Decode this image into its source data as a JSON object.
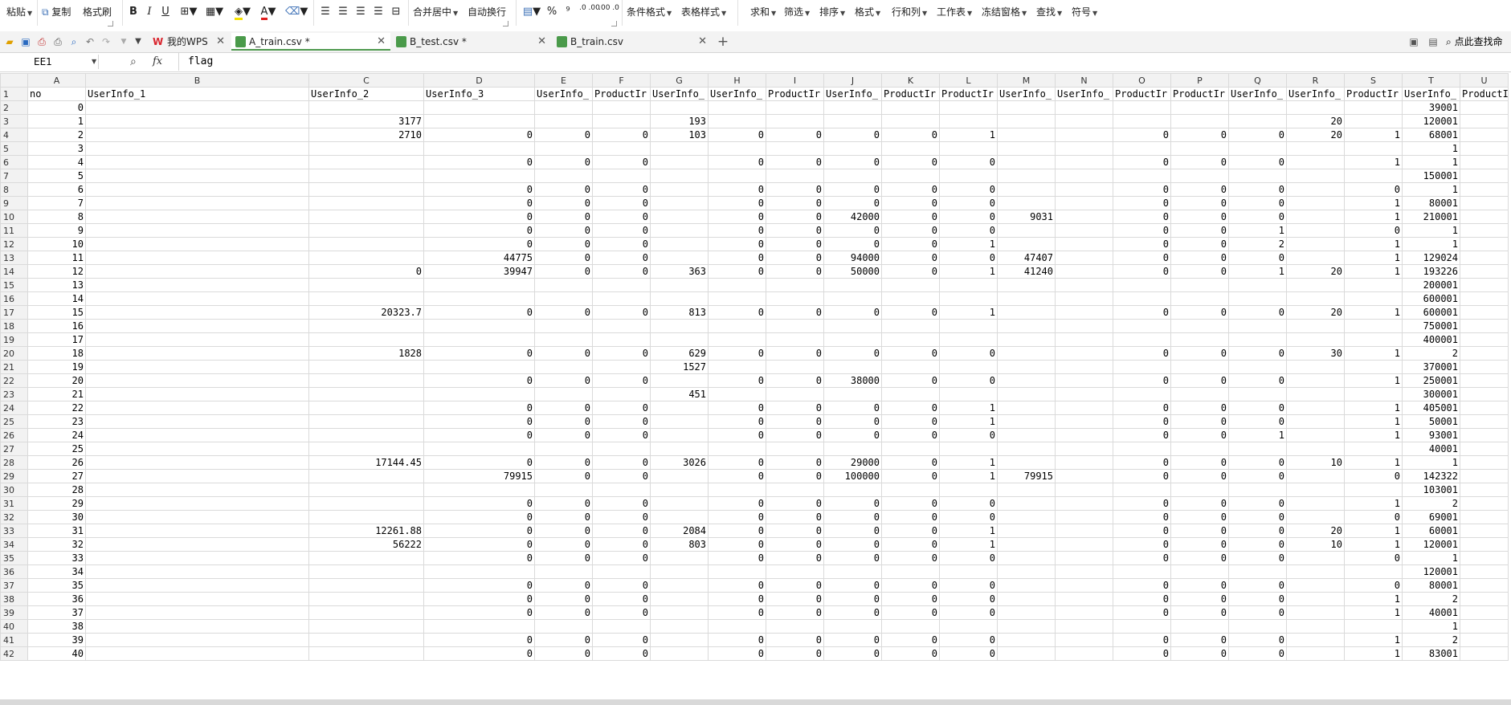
{
  "ribbon": {
    "paste": "粘贴",
    "copy": "复制",
    "format_painter": "格式刷",
    "bold": "B",
    "italic": "I",
    "underline": "U",
    "font_color_letter": "A",
    "merge_center": "合并居中",
    "wrap_text": "自动换行",
    "percent": "%",
    "comma": "⁹",
    "inc_decimal": ".0 .00",
    "dec_decimal": ".00 .0",
    "cond_format": "条件格式",
    "table_style": "表格样式",
    "sum": "求和",
    "filter": "筛选",
    "sort": "排序",
    "format": "格式",
    "rows_cols": "行和列",
    "worksheet": "工作表",
    "freeze": "冻结窗格",
    "find": "查找",
    "symbol": "符号"
  },
  "tabs": [
    {
      "label": "我的WPS",
      "closable": false,
      "active": false
    },
    {
      "label": "A_train.csv *",
      "closable": true,
      "active": true
    },
    {
      "label": "B_test.csv *",
      "closable": true,
      "active": false
    },
    {
      "label": "B_train.csv",
      "closable": true,
      "active": false
    }
  ],
  "search_hint": "点此查找命",
  "formula_bar": {
    "cell_ref": "EE1",
    "fx": "fx",
    "content": "flag"
  },
  "columns": [
    "A",
    "B",
    "C",
    "D",
    "E",
    "F",
    "G",
    "H",
    "I",
    "J",
    "K",
    "L",
    "M",
    "N",
    "O",
    "P",
    "Q",
    "R",
    "S",
    "T",
    "U"
  ],
  "headers": [
    "no",
    "UserInfo_1",
    "UserInfo_2",
    "UserInfo_3",
    "UserInfo_",
    "ProductIr",
    "UserInfo_",
    "UserInfo_",
    "ProductIr",
    "UserInfo_",
    "ProductIr",
    "ProductIr",
    "UserInfo_",
    "UserInfo_",
    "ProductIr",
    "ProductIr",
    "UserInfo_",
    "UserInfo_",
    "ProductIr",
    "UserInfo_",
    "ProductI"
  ],
  "rows": [
    [
      "0",
      "",
      "",
      "",
      "",
      "",
      "",
      "",
      "",
      "",
      "",
      "",
      "",
      "",
      "",
      "",
      "",
      "",
      "",
      "39001",
      ""
    ],
    [
      "1",
      "",
      "3177",
      "",
      "",
      "",
      "193",
      "",
      "",
      "",
      "",
      "",
      "",
      "",
      "",
      "",
      "",
      "20",
      "",
      "120001",
      ""
    ],
    [
      "2",
      "",
      "2710",
      "0",
      "0",
      "0",
      "103",
      "0",
      "0",
      "0",
      "0",
      "1",
      "",
      "",
      "0",
      "0",
      "0",
      "20",
      "1",
      "68001",
      ""
    ],
    [
      "3",
      "",
      "",
      "",
      "",
      "",
      "",
      "",
      "",
      "",
      "",
      "",
      "",
      "",
      "",
      "",
      "",
      "",
      "",
      "1",
      ""
    ],
    [
      "4",
      "",
      "",
      "0",
      "0",
      "0",
      "",
      "0",
      "0",
      "0",
      "0",
      "0",
      "",
      "",
      "0",
      "0",
      "0",
      "",
      "1",
      "1",
      ""
    ],
    [
      "5",
      "",
      "",
      "",
      "",
      "",
      "",
      "",
      "",
      "",
      "",
      "",
      "",
      "",
      "",
      "",
      "",
      "",
      "",
      "150001",
      ""
    ],
    [
      "6",
      "",
      "",
      "0",
      "0",
      "0",
      "",
      "0",
      "0",
      "0",
      "0",
      "0",
      "",
      "",
      "0",
      "0",
      "0",
      "",
      "0",
      "1",
      ""
    ],
    [
      "7",
      "",
      "",
      "0",
      "0",
      "0",
      "",
      "0",
      "0",
      "0",
      "0",
      "0",
      "",
      "",
      "0",
      "0",
      "0",
      "",
      "1",
      "80001",
      ""
    ],
    [
      "8",
      "",
      "",
      "0",
      "0",
      "0",
      "",
      "0",
      "0",
      "42000",
      "0",
      "0",
      "9031",
      "",
      "0",
      "0",
      "0",
      "",
      "1",
      "210001",
      ""
    ],
    [
      "9",
      "",
      "",
      "0",
      "0",
      "0",
      "",
      "0",
      "0",
      "0",
      "0",
      "0",
      "",
      "",
      "0",
      "0",
      "1",
      "",
      "0",
      "1",
      ""
    ],
    [
      "10",
      "",
      "",
      "0",
      "0",
      "0",
      "",
      "0",
      "0",
      "0",
      "0",
      "1",
      "",
      "",
      "0",
      "0",
      "2",
      "",
      "1",
      "1",
      ""
    ],
    [
      "11",
      "",
      "",
      "44775",
      "0",
      "0",
      "",
      "0",
      "0",
      "94000",
      "0",
      "0",
      "47407",
      "",
      "0",
      "0",
      "0",
      "",
      "1",
      "129024",
      ""
    ],
    [
      "12",
      "",
      "0",
      "39947",
      "0",
      "0",
      "363",
      "0",
      "0",
      "50000",
      "0",
      "1",
      "41240",
      "",
      "0",
      "0",
      "1",
      "20",
      "1",
      "193226",
      ""
    ],
    [
      "13",
      "",
      "",
      "",
      "",
      "",
      "",
      "",
      "",
      "",
      "",
      "",
      "",
      "",
      "",
      "",
      "",
      "",
      "",
      "200001",
      ""
    ],
    [
      "14",
      "",
      "",
      "",
      "",
      "",
      "",
      "",
      "",
      "",
      "",
      "",
      "",
      "",
      "",
      "",
      "",
      "",
      "",
      "600001",
      ""
    ],
    [
      "15",
      "",
      "20323.7",
      "0",
      "0",
      "0",
      "813",
      "0",
      "0",
      "0",
      "0",
      "1",
      "",
      "",
      "0",
      "0",
      "0",
      "20",
      "1",
      "600001",
      ""
    ],
    [
      "16",
      "",
      "",
      "",
      "",
      "",
      "",
      "",
      "",
      "",
      "",
      "",
      "",
      "",
      "",
      "",
      "",
      "",
      "",
      "750001",
      ""
    ],
    [
      "17",
      "",
      "",
      "",
      "",
      "",
      "",
      "",
      "",
      "",
      "",
      "",
      "",
      "",
      "",
      "",
      "",
      "",
      "",
      "400001",
      ""
    ],
    [
      "18",
      "",
      "1828",
      "0",
      "0",
      "0",
      "629",
      "0",
      "0",
      "0",
      "0",
      "0",
      "",
      "",
      "0",
      "0",
      "0",
      "30",
      "1",
      "2",
      ""
    ],
    [
      "19",
      "",
      "",
      "",
      "",
      "",
      "1527",
      "",
      "",
      "",
      "",
      "",
      "",
      "",
      "",
      "",
      "",
      "",
      "",
      "370001",
      ""
    ],
    [
      "20",
      "",
      "",
      "0",
      "0",
      "0",
      "",
      "0",
      "0",
      "38000",
      "0",
      "0",
      "",
      "",
      "0",
      "0",
      "0",
      "",
      "1",
      "250001",
      ""
    ],
    [
      "21",
      "",
      "",
      "",
      "",
      "",
      "451",
      "",
      "",
      "",
      "",
      "",
      "",
      "",
      "",
      "",
      "",
      "",
      "",
      "300001",
      ""
    ],
    [
      "22",
      "",
      "",
      "0",
      "0",
      "0",
      "",
      "0",
      "0",
      "0",
      "0",
      "1",
      "",
      "",
      "0",
      "0",
      "0",
      "",
      "1",
      "405001",
      ""
    ],
    [
      "23",
      "",
      "",
      "0",
      "0",
      "0",
      "",
      "0",
      "0",
      "0",
      "0",
      "1",
      "",
      "",
      "0",
      "0",
      "0",
      "",
      "1",
      "50001",
      ""
    ],
    [
      "24",
      "",
      "",
      "0",
      "0",
      "0",
      "",
      "0",
      "0",
      "0",
      "0",
      "0",
      "",
      "",
      "0",
      "0",
      "1",
      "",
      "1",
      "93001",
      ""
    ],
    [
      "25",
      "",
      "",
      "",
      "",
      "",
      "",
      "",
      "",
      "",
      "",
      "",
      "",
      "",
      "",
      "",
      "",
      "",
      "",
      "40001",
      ""
    ],
    [
      "26",
      "",
      "17144.45",
      "0",
      "0",
      "0",
      "3026",
      "0",
      "0",
      "29000",
      "0",
      "1",
      "",
      "",
      "0",
      "0",
      "0",
      "10",
      "1",
      "1",
      ""
    ],
    [
      "27",
      "",
      "",
      "79915",
      "0",
      "0",
      "",
      "0",
      "0",
      "100000",
      "0",
      "1",
      "79915",
      "",
      "0",
      "0",
      "0",
      "",
      "0",
      "142322",
      ""
    ],
    [
      "28",
      "",
      "",
      "",
      "",
      "",
      "",
      "",
      "",
      "",
      "",
      "",
      "",
      "",
      "",
      "",
      "",
      "",
      "",
      "103001",
      ""
    ],
    [
      "29",
      "",
      "",
      "0",
      "0",
      "0",
      "",
      "0",
      "0",
      "0",
      "0",
      "0",
      "",
      "",
      "0",
      "0",
      "0",
      "",
      "1",
      "2",
      ""
    ],
    [
      "30",
      "",
      "",
      "0",
      "0",
      "0",
      "",
      "0",
      "0",
      "0",
      "0",
      "0",
      "",
      "",
      "0",
      "0",
      "0",
      "",
      "0",
      "69001",
      ""
    ],
    [
      "31",
      "",
      "12261.88",
      "0",
      "0",
      "0",
      "2084",
      "0",
      "0",
      "0",
      "0",
      "1",
      "",
      "",
      "0",
      "0",
      "0",
      "20",
      "1",
      "60001",
      ""
    ],
    [
      "32",
      "",
      "56222",
      "0",
      "0",
      "0",
      "803",
      "0",
      "0",
      "0",
      "0",
      "1",
      "",
      "",
      "0",
      "0",
      "0",
      "10",
      "1",
      "120001",
      ""
    ],
    [
      "33",
      "",
      "",
      "0",
      "0",
      "0",
      "",
      "0",
      "0",
      "0",
      "0",
      "0",
      "",
      "",
      "0",
      "0",
      "0",
      "",
      "0",
      "1",
      ""
    ],
    [
      "34",
      "",
      "",
      "",
      "",
      "",
      "",
      "",
      "",
      "",
      "",
      "",
      "",
      "",
      "",
      "",
      "",
      "",
      "",
      "120001",
      ""
    ],
    [
      "35",
      "",
      "",
      "0",
      "0",
      "0",
      "",
      "0",
      "0",
      "0",
      "0",
      "0",
      "",
      "",
      "0",
      "0",
      "0",
      "",
      "0",
      "80001",
      ""
    ],
    [
      "36",
      "",
      "",
      "0",
      "0",
      "0",
      "",
      "0",
      "0",
      "0",
      "0",
      "0",
      "",
      "",
      "0",
      "0",
      "0",
      "",
      "1",
      "2",
      ""
    ],
    [
      "37",
      "",
      "",
      "0",
      "0",
      "0",
      "",
      "0",
      "0",
      "0",
      "0",
      "0",
      "",
      "",
      "0",
      "0",
      "0",
      "",
      "1",
      "40001",
      ""
    ],
    [
      "38",
      "",
      "",
      "",
      "",
      "",
      "",
      "",
      "",
      "",
      "",
      "",
      "",
      "",
      "",
      "",
      "",
      "",
      "",
      "1",
      ""
    ],
    [
      "39",
      "",
      "",
      "0",
      "0",
      "0",
      "",
      "0",
      "0",
      "0",
      "0",
      "0",
      "",
      "",
      "0",
      "0",
      "0",
      "",
      "1",
      "2",
      ""
    ],
    [
      "40",
      "",
      "",
      "0",
      "0",
      "0",
      "",
      "0",
      "0",
      "0",
      "0",
      "0",
      "",
      "",
      "0",
      "0",
      "0",
      "",
      "1",
      "83001",
      ""
    ]
  ],
  "colors": {
    "active_tab_accent": "#4f9a4f",
    "wps_logo": "#d9252e",
    "csv_icon": "#4a9a4a",
    "grid_line": "#dadada",
    "header_bg": "#f2f2f2"
  }
}
